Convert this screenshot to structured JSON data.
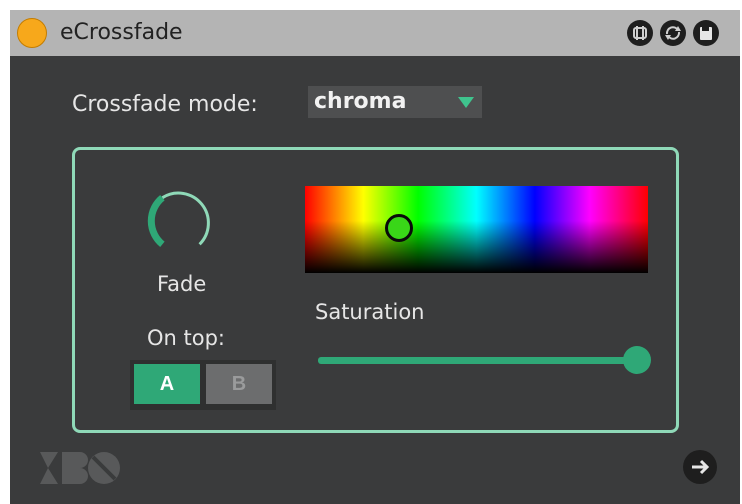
{
  "titlebar": {
    "title": "eCrossfade",
    "power_icon": "power-toggle-icon"
  },
  "mode": {
    "label": "Crossfade mode:",
    "value": "chroma",
    "accent": "#3fc48e"
  },
  "fade": {
    "label": "Fade"
  },
  "ontop": {
    "label": "On top:",
    "a_label": "A",
    "b_label": "B",
    "selected": "A"
  },
  "saturation": {
    "label": "Saturation",
    "value": 1.0
  },
  "colors": {
    "accent": "#2fa877",
    "panel_border": "#8fd9b8",
    "background": "#3a3b3c",
    "power": "#f7a81b"
  }
}
